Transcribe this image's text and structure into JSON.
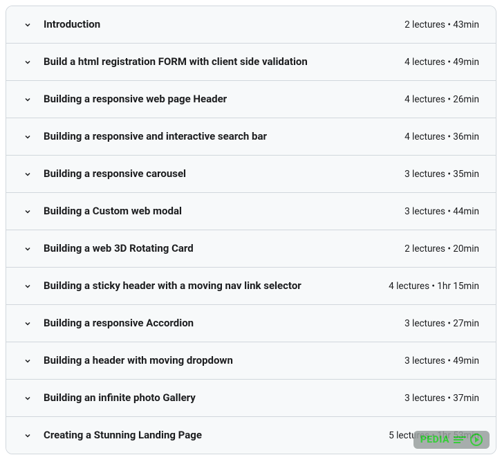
{
  "sections": [
    {
      "title": "Introduction",
      "meta": "2 lectures • 43min"
    },
    {
      "title": "Build a html registration FORM with client side validation",
      "meta": "4 lectures • 49min"
    },
    {
      "title": "Building a responsive web page Header",
      "meta": "4 lectures • 26min"
    },
    {
      "title": "Building a responsive and interactive search bar",
      "meta": "4 lectures • 36min"
    },
    {
      "title": "Building a responsive carousel",
      "meta": "3 lectures • 35min"
    },
    {
      "title": "Building a Custom web modal",
      "meta": "3 lectures • 44min"
    },
    {
      "title": "Building a web 3D Rotating Card",
      "meta": "2 lectures • 20min"
    },
    {
      "title": "Building a sticky header with a moving nav link selector",
      "meta": "4 lectures • 1hr 15min"
    },
    {
      "title": "Building a responsive Accordion",
      "meta": "3 lectures • 27min"
    },
    {
      "title": "Building a header with moving dropdown",
      "meta": "3 lectures • 49min"
    },
    {
      "title": "Building an infinite photo Gallery",
      "meta": "3 lectures • 37min"
    },
    {
      "title": "Creating a Stunning Landing Page",
      "meta": "5 lectures • 1hr 53min"
    }
  ],
  "watermark": {
    "text": "PEDIA"
  }
}
